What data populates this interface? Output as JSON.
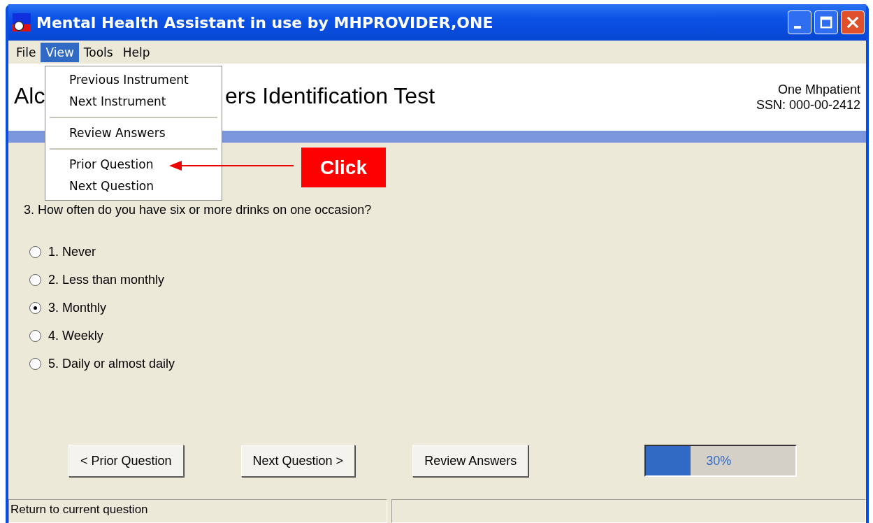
{
  "window": {
    "title": "Mental Health Assistant in use by MHPROVIDER,ONE"
  },
  "menu_bar": [
    {
      "label": "File",
      "selected": false
    },
    {
      "label": "View",
      "selected": true
    },
    {
      "label": "Tools",
      "selected": false
    },
    {
      "label": "Help",
      "selected": false
    }
  ],
  "view_menu": [
    [
      {
        "label": "Previous Instrument"
      },
      {
        "label": "Next Instrument"
      }
    ],
    [
      {
        "label": "Review Answers"
      }
    ],
    [
      {
        "label": "Prior Question"
      },
      {
        "label": "Next Question"
      }
    ]
  ],
  "header": {
    "title_parts": [
      "Alc",
      "ers Identification Test"
    ],
    "patient_name": "One Mhpatient",
    "ssn": "SSN: 000-00-2412"
  },
  "callout": {
    "label": "Click"
  },
  "question": {
    "text": "3. How often do you have six or more drinks on one occasion?",
    "options": [
      {
        "label": "1. Never",
        "selected": false
      },
      {
        "label": "2. Less than monthly",
        "selected": false
      },
      {
        "label": "3. Monthly",
        "selected": true
      },
      {
        "label": "4. Weekly",
        "selected": false
      },
      {
        "label": "5. Daily or almost daily",
        "selected": false
      }
    ]
  },
  "buttons": [
    "< Prior Question",
    "Next Question >",
    "Review Answers"
  ],
  "progress": {
    "level": 0.3,
    "reading": "30%"
  },
  "status_bar": [
    "Return to current question"
  ]
}
